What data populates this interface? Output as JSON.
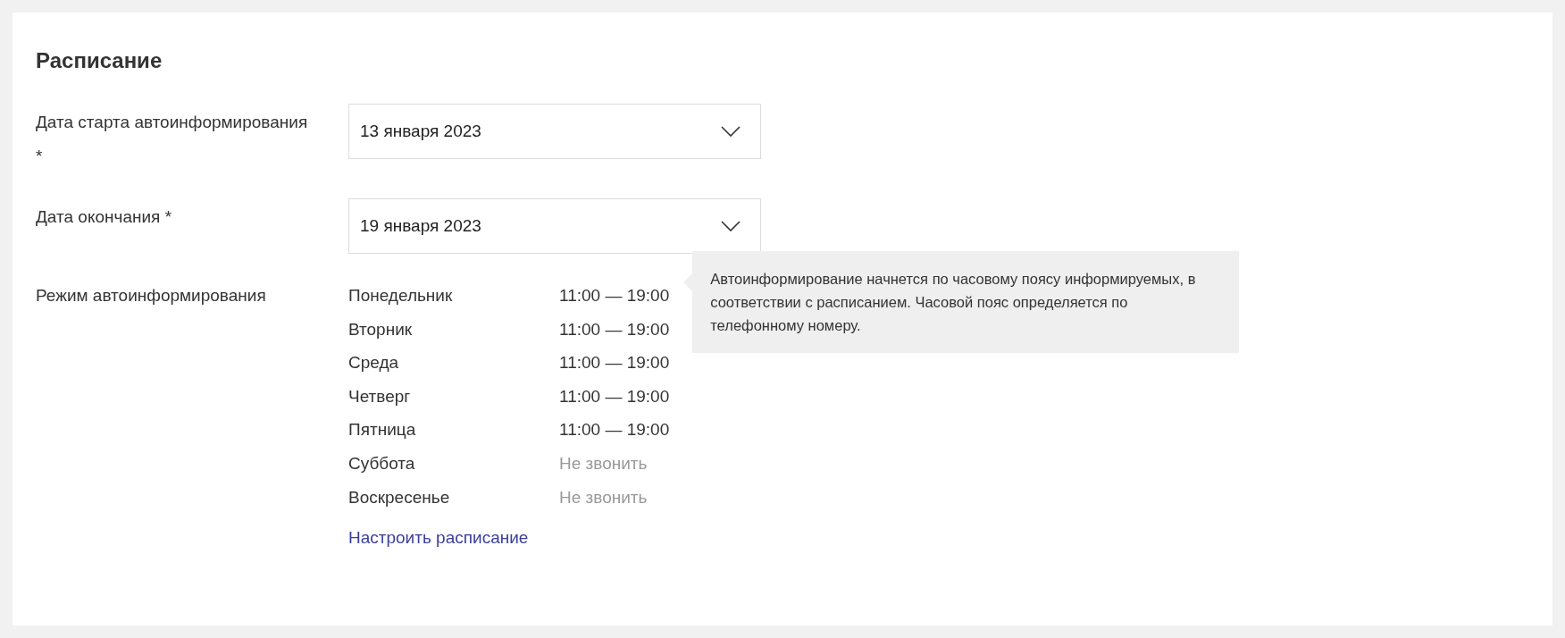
{
  "title": "Расписание",
  "fields": [
    {
      "label": "Дата старта автоинформирования *",
      "value": "13 января 2023"
    },
    {
      "label": "Дата окончания *",
      "value": "19 января 2023"
    }
  ],
  "schedule": {
    "label": "Режим автоинформирования",
    "days": [
      {
        "day": "Понедельник",
        "time": "11:00 — 19:00",
        "kind": "call"
      },
      {
        "day": "Вторник",
        "time": "11:00 — 19:00",
        "kind": "call"
      },
      {
        "day": "Среда",
        "time": "11:00 — 19:00",
        "kind": "call"
      },
      {
        "day": "Четверг",
        "time": "11:00 — 19:00",
        "kind": "call"
      },
      {
        "day": "Пятница",
        "time": "11:00 — 19:00",
        "kind": "call"
      },
      {
        "day": "Суббота",
        "time": "Не звонить",
        "kind": "off"
      },
      {
        "day": "Воскресенье",
        "time": "Не звонить",
        "kind": "off"
      }
    ],
    "hint": "Автоинформирование начнется по часовому поясу информируемых, в соответствии с расписанием. Часовой пояс определяется по телефонному номеру.",
    "link": "Настроить расписание"
  }
}
